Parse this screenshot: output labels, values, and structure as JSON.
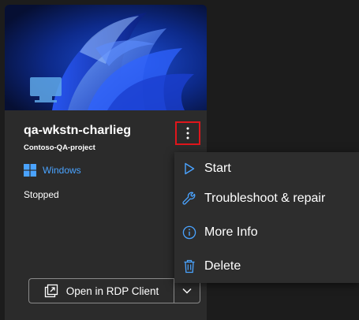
{
  "card": {
    "title": "qa-wkstn-charlieg",
    "project": "Contoso-QA-project",
    "os": "Windows",
    "status": "Stopped",
    "rdp_button_label": "Open in RDP Client"
  },
  "menu": {
    "items": [
      {
        "label": "Start",
        "icon": "play-icon"
      },
      {
        "label": "Troubleshoot & repair",
        "icon": "wrench-icon"
      },
      {
        "label": "More Info",
        "icon": "info-icon"
      },
      {
        "label": "Delete",
        "icon": "trash-icon"
      }
    ]
  },
  "colors": {
    "accent": "#4aa3ff",
    "highlight_border": "#e0161c",
    "card_bg": "#2b2b2b",
    "menu_bg": "#2d2d2d",
    "page_bg": "#1c1c1c"
  }
}
